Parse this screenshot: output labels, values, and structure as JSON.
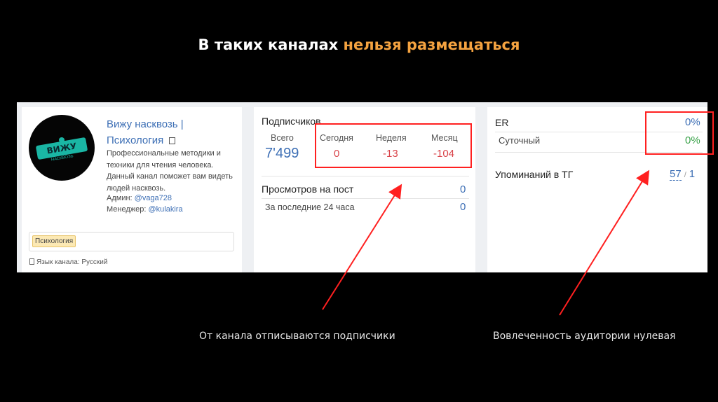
{
  "slide": {
    "title_prefix": "В таких каналах",
    "title_accent": "нельзя размещаться",
    "caption_left": "От канала отписываются подписчики",
    "caption_right": "Вовлеченность аудитории нулевая"
  },
  "profile": {
    "avatar_logo_text": "ВИЖУ",
    "avatar_logo_sub": "НАСКВОЗЬ",
    "name_line1": "Вижу насквозь |",
    "name_line2": "Психология",
    "description": "Профессиональные методики и техники для чтения человека. Данный канал поможет вам видеть людей насквозь.",
    "admin_label": "Админ:",
    "admin_handle": "@vaga728",
    "manager_label": "Менеджер:",
    "manager_handle": "@kulakira",
    "tag": "Психология",
    "language": "Язык канала: Русский"
  },
  "subscribers": {
    "title": "Подписчиков",
    "total_label": "Всего",
    "total_value": "7'499",
    "today_label": "Сегодня",
    "today_value": "0",
    "week_label": "Неделя",
    "week_value": "-13",
    "month_label": "Месяц",
    "month_value": "-104",
    "views_title": "Просмотров на пост",
    "views_value": "0",
    "views_24h_label": "За последние 24 часа",
    "views_24h_value": "0"
  },
  "engagement": {
    "er_label": "ER",
    "er_value": "0%",
    "daily_label": "Суточный",
    "daily_value": "0%",
    "mentions_label": "Упоминаний в ТГ",
    "mentions_total": "57",
    "mentions_divider": "/",
    "mentions_count": "1"
  },
  "colors": {
    "accent": "#f5a340",
    "link_blue": "#3d6fb5",
    "negative_red": "#d9454b",
    "positive_green": "#3aa24a",
    "highlight_red": "#ff2020"
  }
}
